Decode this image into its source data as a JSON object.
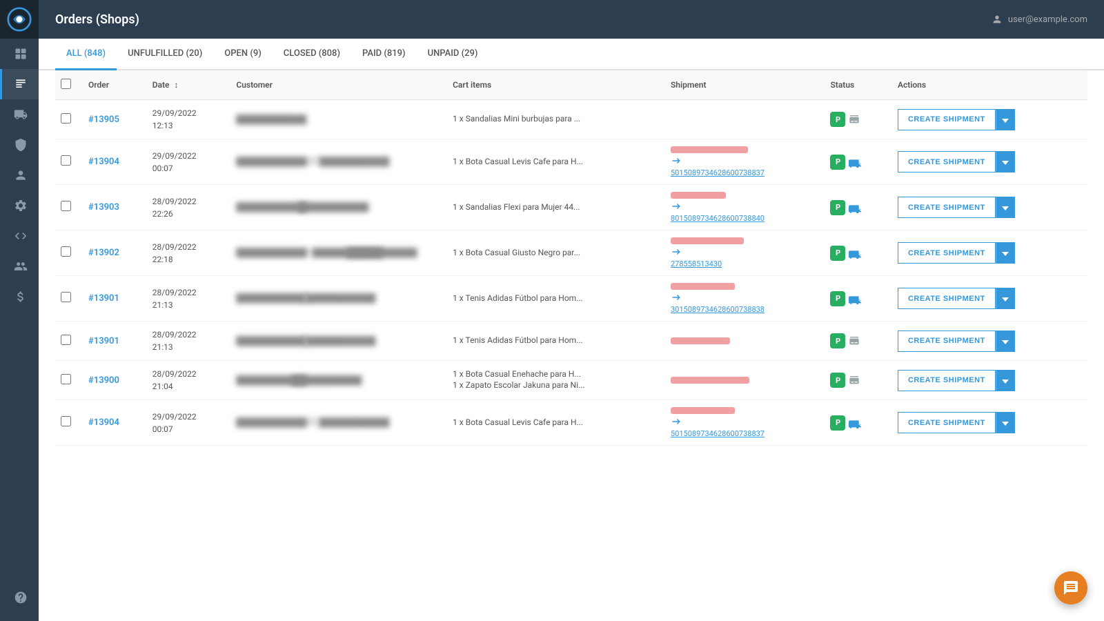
{
  "app": {
    "title": "Orders (Shops)",
    "user": "user@example.com"
  },
  "tabs": [
    {
      "label": "ALL (848)",
      "active": true
    },
    {
      "label": "UNFULFILLED (20)",
      "active": false
    },
    {
      "label": "OPEN (9)",
      "active": false
    },
    {
      "label": "CLOSED (808)",
      "active": false
    },
    {
      "label": "PAID (819)",
      "active": false
    },
    {
      "label": "UNPAID (29)",
      "active": false
    }
  ],
  "table": {
    "columns": [
      "",
      "Order",
      "Date",
      "Customer",
      "Cart items",
      "Shipment",
      "Status",
      "Actions"
    ],
    "create_btn": "CREATE SHIPMENT"
  },
  "orders": [
    {
      "id": "#13905",
      "date": "29/09/2022",
      "time": "12:13",
      "cart_items": [
        "1 x Sandalias Mini burbujas para ..."
      ],
      "tracking": null,
      "has_shipment": false,
      "status_p": true
    },
    {
      "id": "#13904",
      "date": "29/09/2022",
      "time": "00:07",
      "cart_items": [
        "1 x Bota Casual Levis Cafe para H..."
      ],
      "tracking": "501508973462860073883​7",
      "has_shipment": true,
      "status_p": true
    },
    {
      "id": "#13903",
      "date": "28/09/2022",
      "time": "22:26",
      "cart_items": [
        "1 x Sandalias Flexi para Mujer 44..."
      ],
      "tracking": "801508973462860073884​0",
      "has_shipment": true,
      "status_p": true
    },
    {
      "id": "#13902",
      "date": "28/09/2022",
      "time": "22:18",
      "cart_items": [
        "1 x Bota Casual Giusto Negro par..."
      ],
      "tracking": "278558513430",
      "has_shipment": true,
      "status_p": true
    },
    {
      "id": "#13901",
      "date": "28/09/2022",
      "time": "21:13",
      "cart_items": [
        "1 x Tenis Adidas Fútbol para Hom..."
      ],
      "tracking": "301508973462860073883​8",
      "has_shipment": true,
      "status_p": true
    },
    {
      "id": "#13901",
      "date": "28/09/2022",
      "time": "21:13",
      "cart_items": [
        "1 x Tenis Adidas Fútbol para Hom..."
      ],
      "tracking": null,
      "has_shipment": false,
      "status_p": true
    },
    {
      "id": "#13900",
      "date": "28/09/2022",
      "time": "21:04",
      "cart_items": [
        "1 x Bota Casual Enehache para H...",
        "1 x Zapato Escolar Jakuna para Ni..."
      ],
      "tracking": null,
      "has_shipment": true,
      "status_p": true
    },
    {
      "id": "#13904",
      "date": "29/09/2022",
      "time": "00:07",
      "cart_items": [
        "1 x Bota Casual Levis Cafe para H..."
      ],
      "tracking": "501508973462860073883​7",
      "has_shipment": true,
      "status_p": true
    }
  ],
  "sidebar": {
    "icons": [
      {
        "name": "grid-icon",
        "label": "Dashboard"
      },
      {
        "name": "orders-icon",
        "label": "Orders",
        "active": true
      },
      {
        "name": "truck-icon",
        "label": "Shipments"
      },
      {
        "name": "lock-icon",
        "label": "Security"
      },
      {
        "name": "person-icon",
        "label": "Users"
      },
      {
        "name": "settings-icon",
        "label": "Settings"
      },
      {
        "name": "dev-icon",
        "label": "Developer"
      },
      {
        "name": "team-icon",
        "label": "Team"
      },
      {
        "name": "money-icon",
        "label": "Finance"
      },
      {
        "name": "help-icon",
        "label": "Help"
      }
    ]
  }
}
